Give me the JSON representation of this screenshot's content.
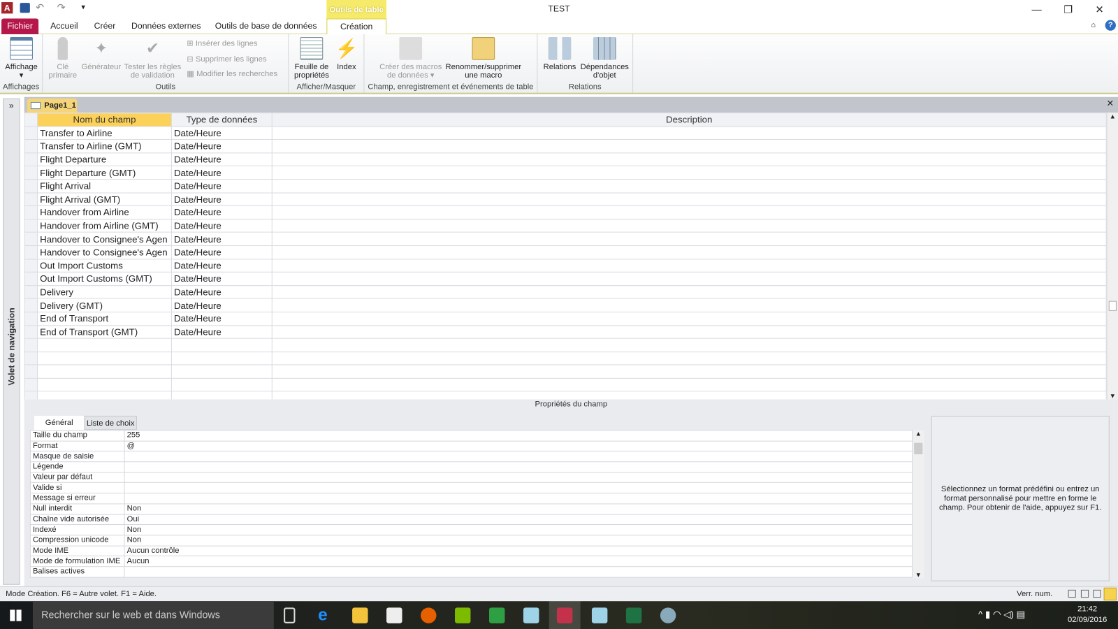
{
  "window": {
    "title": "TEST",
    "contextual_tab": "Outils de table",
    "controls": {
      "minimize": "—",
      "restore": "❐",
      "close": "✕"
    }
  },
  "ribbon_tabs": [
    "Fichier",
    "Accueil",
    "Créer",
    "Données externes",
    "Outils de base de données",
    "Création"
  ],
  "ribbon": {
    "groups": {
      "affichages": "Affichages",
      "outils": "Outils",
      "afficher": "Afficher/Masquer",
      "champ": "Champ, enregistrement et événements de table",
      "relations": "Relations"
    },
    "buttons": {
      "affichage": "Affichage",
      "cle": "Clé primaire",
      "generateur": "Générateur",
      "tester": "Tester les règles de validation",
      "inserer": "Insérer des lignes",
      "supprimer": "Supprimer les lignes",
      "modifier": "Modifier les recherches",
      "feuille": "Feuille de propriétés",
      "index": "Index",
      "creer_macros": "Créer des macros de données",
      "renommer": "Renommer/supprimer une macro",
      "relations": "Relations",
      "dependances": "Dépendances d'objet"
    }
  },
  "nav_pane": {
    "label": "Volet de navigation",
    "toggle": "»"
  },
  "document": {
    "tab": "Page1_1",
    "close": "✕"
  },
  "grid": {
    "headers": [
      "Nom du champ",
      "Type de données",
      "Description"
    ],
    "rows": [
      [
        "Transfer to Airline",
        "Date/Heure"
      ],
      [
        "Transfer to Airline (GMT)",
        "Date/Heure"
      ],
      [
        "Flight Departure",
        "Date/Heure"
      ],
      [
        "Flight Departure (GMT)",
        "Date/Heure"
      ],
      [
        "Flight Arrival",
        "Date/Heure"
      ],
      [
        "Flight Arrival (GMT)",
        "Date/Heure"
      ],
      [
        "Handover from Airline",
        "Date/Heure"
      ],
      [
        "Handover from Airline (GMT)",
        "Date/Heure"
      ],
      [
        "Handover to Consignee's Agen",
        "Date/Heure"
      ],
      [
        "Handover to Consignee's Agen",
        "Date/Heure"
      ],
      [
        "Out Import Customs",
        "Date/Heure"
      ],
      [
        "Out Import Customs (GMT)",
        "Date/Heure"
      ],
      [
        "Delivery",
        "Date/Heure"
      ],
      [
        "Delivery (GMT)",
        "Date/Heure"
      ],
      [
        "End of Transport",
        "Date/Heure"
      ],
      [
        "End of Transport (GMT)",
        "Date/Heure"
      ]
    ]
  },
  "properties": {
    "header": "Propriétés du champ",
    "tabs": [
      "Général",
      "Liste de choix"
    ],
    "rows": [
      [
        "Taille du champ",
        "255"
      ],
      [
        "Format",
        "@"
      ],
      [
        "Masque de saisie",
        ""
      ],
      [
        "Légende",
        ""
      ],
      [
        "Valeur par défaut",
        ""
      ],
      [
        "Valide si",
        ""
      ],
      [
        "Message si erreur",
        ""
      ],
      [
        "Null interdit",
        "Non"
      ],
      [
        "Chaîne vide autorisée",
        "Oui"
      ],
      [
        "Indexé",
        "Non"
      ],
      [
        "Compression unicode",
        "Non"
      ],
      [
        "Mode IME",
        "Aucun contrôle"
      ],
      [
        "Mode de formulation IME",
        "Aucun"
      ],
      [
        "Balises actives",
        ""
      ]
    ],
    "help": "Sélectionnez un format prédéfini ou entrez un format personnalisé pour mettre en forme le champ. Pour obtenir de l'aide, appuyez sur F1."
  },
  "status": {
    "left": "Mode Création. F6 = Autre volet. F1 = Aide.",
    "right": "Verr. num."
  },
  "taskbar": {
    "search": "Rechercher sur le web et dans Windows",
    "time": "21:42",
    "date": "02/09/2016"
  },
  "colors": {
    "fichier": "#b5174a",
    "context": "#f5ea6a",
    "header_selected": "#fbd15a"
  }
}
